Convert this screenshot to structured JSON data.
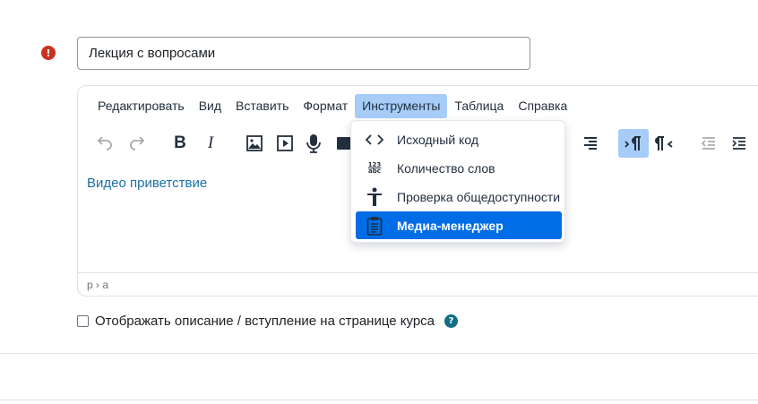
{
  "name_field": {
    "value": "Лекция с вопросами",
    "required_icon": "exclamation-circle-icon"
  },
  "editor": {
    "menubar": {
      "items": [
        {
          "label": "Редактировать"
        },
        {
          "label": "Вид"
        },
        {
          "label": "Вставить"
        },
        {
          "label": "Формат"
        },
        {
          "label": "Инструменты",
          "active": true
        },
        {
          "label": "Таблица"
        },
        {
          "label": "Справка"
        }
      ]
    },
    "toolbar": {
      "buttons": [
        "undo-icon",
        "redo-icon",
        "bold-icon",
        "italic-icon",
        "image-icon",
        "video-icon",
        "microphone-icon",
        "align-right-icon",
        "ltr-icon",
        "rtl-icon",
        "outdent-icon",
        "indent-icon"
      ],
      "bold_glyph": "B",
      "italic_glyph": "I"
    },
    "content": {
      "link_text": "Видео приветствие"
    },
    "statusbar": {
      "path": "p › a"
    },
    "tools_menu": {
      "items": [
        {
          "label": "Исходный код",
          "icon": "source-code-icon"
        },
        {
          "label": "Количество слов",
          "icon": "word-count-icon",
          "icon_text_top": "123",
          "icon_text_bottom": "abc"
        },
        {
          "label": "Проверка общедоступности",
          "icon": "accessibility-icon"
        },
        {
          "label": "Медиа-менеджер",
          "icon": "media-manager-icon",
          "selected": true
        }
      ]
    }
  },
  "show_description": {
    "label": "Отображать описание / вступление на странице курса",
    "checked": false,
    "help_icon": "question-circle-icon",
    "help_glyph": "?"
  },
  "colors": {
    "accent": "#006ce6",
    "menu_active": "#a6ccf7",
    "required": "#ca3120",
    "help": "#0f6e84",
    "link": "#1a6fa8"
  }
}
